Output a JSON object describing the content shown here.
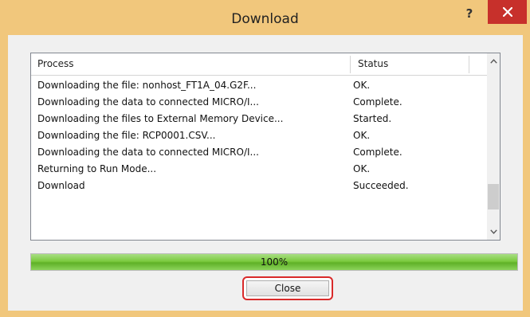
{
  "window": {
    "title": "Download",
    "help_label": "?",
    "close_icon": "close-icon",
    "frame_color": "#f1c77c",
    "close_color": "#c7302b"
  },
  "list": {
    "headers": [
      "Process",
      "Status"
    ],
    "rows": [
      {
        "process": "Downloading the file: nonhost_FT1A_04.G2F...",
        "status": "OK."
      },
      {
        "process": "Downloading the data to connected MICRO/I...",
        "status": "Complete."
      },
      {
        "process": "Downloading the files to External Memory Device...",
        "status": "Started."
      },
      {
        "process": "Downloading the file: RCP0001.CSV...",
        "status": "OK."
      },
      {
        "process": "Downloading the data to connected MICRO/I...",
        "status": "Complete."
      },
      {
        "process": "Returning to Run Mode...",
        "status": "OK."
      },
      {
        "process": "Download",
        "status": "Succeeded."
      }
    ],
    "scroll_up_icon": "chevron-up-icon",
    "scroll_down_icon": "chevron-down-icon"
  },
  "progress": {
    "label": "100%",
    "value": 1.0,
    "color": "#6fc030"
  },
  "footer": {
    "close_label": "Close",
    "highlight_color": "#d92a2a"
  }
}
